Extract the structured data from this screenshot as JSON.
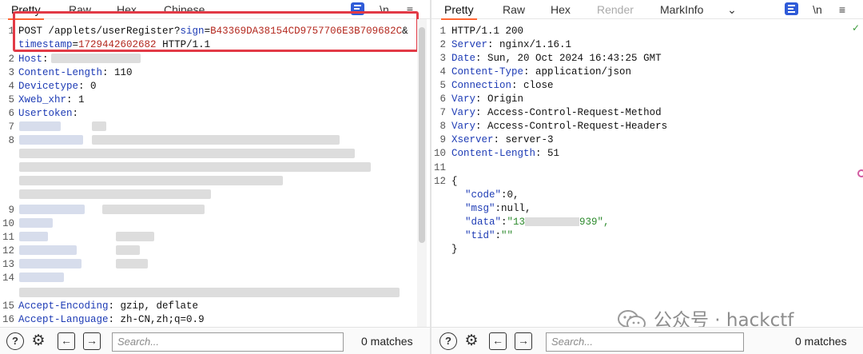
{
  "request": {
    "tabs": [
      "Pretty",
      "Raw",
      "Hex",
      "Chinese"
    ],
    "active_tab": "Pretty",
    "newline_toggle": "\\n",
    "line1": {
      "method_path": "POST /applets/userRegister?",
      "sign_key": "sign",
      "sign_value": "B43369DA38154CD9757706E3B709682C",
      "amp": "&",
      "ts_key": "timestamp",
      "ts_value": "1729442602682",
      "proto": " HTTP/1.1"
    },
    "headers": [
      {
        "n": "2",
        "key": "Host",
        "value": ""
      },
      {
        "n": "3",
        "key": "Content-Length",
        "value": "110"
      },
      {
        "n": "4",
        "key": "Devicetype",
        "value": "0"
      },
      {
        "n": "5",
        "key": "Xweb_xhr",
        "value": "1"
      },
      {
        "n": "6",
        "key": "Usertoken",
        "value": ""
      }
    ],
    "blurred_line_numbers": [
      "7",
      "8",
      "9",
      "10",
      "11",
      "12",
      "13",
      "14"
    ],
    "tail_headers": [
      {
        "n": "15",
        "key": "Accept-Encoding",
        "value": "gzip, deflate"
      },
      {
        "n": "16",
        "key": "Accept-Language",
        "value": "zh-CN,zh;q=0.9"
      }
    ],
    "search_placeholder": "Search...",
    "matches": "0 matches"
  },
  "response": {
    "tabs": [
      "Pretty",
      "Raw",
      "Hex",
      "Render",
      "MarkInfo"
    ],
    "active_tab": "Pretty",
    "newline_toggle": "\\n",
    "status_line": "HTTP/1.1 200",
    "headers": [
      {
        "n": "2",
        "key": "Server",
        "value": "nginx/1.16.1"
      },
      {
        "n": "3",
        "key": "Date",
        "value": "Sun, 20 Oct 2024 16:43:25 GMT"
      },
      {
        "n": "4",
        "key": "Content-Type",
        "value": "application/json"
      },
      {
        "n": "5",
        "key": "Connection",
        "value": "close"
      },
      {
        "n": "6",
        "key": "Vary",
        "value": "Origin"
      },
      {
        "n": "7",
        "key": "Vary",
        "value": "Access-Control-Request-Method"
      },
      {
        "n": "8",
        "key": "Vary",
        "value": "Access-Control-Request-Headers"
      },
      {
        "n": "9",
        "key": "Xserver",
        "value": "server-3"
      },
      {
        "n": "10",
        "key": "Content-Length",
        "value": "51"
      }
    ],
    "blank_line": "11",
    "body_line": "12",
    "json": {
      "open": "{",
      "close": "}",
      "code_key": "\"code\"",
      "code_val": "0,",
      "msg_key": "\"msg\"",
      "msg_val": "null,",
      "data_key": "\"data\"",
      "data_val_start": "\"13",
      "data_val_end": "939\",",
      "tid_key": "\"tid\"",
      "tid_val": "\"\""
    },
    "search_placeholder": "Search...",
    "matches": "0 matches"
  },
  "watermark": "公众号 · hackctf",
  "colors": {
    "accent_tab": "#ff6633",
    "highlight_box": "#e23a46",
    "param_value": "#b4291f",
    "key": "#1d3bb5",
    "json_string": "#2d8a2d"
  }
}
